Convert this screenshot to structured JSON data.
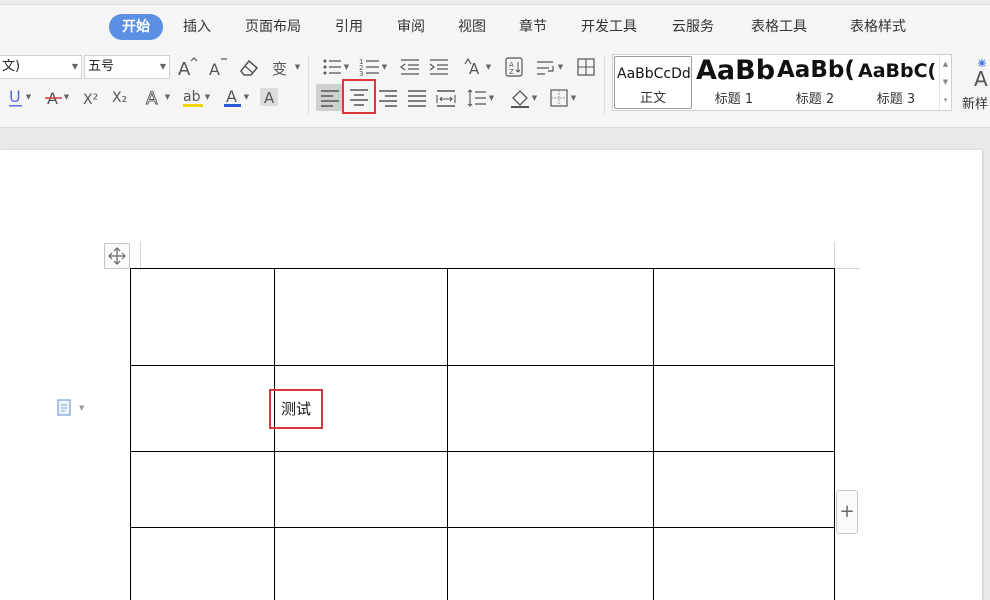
{
  "ribbon": {
    "tabs": [
      {
        "label": "开始",
        "active": true
      },
      {
        "label": "插入"
      },
      {
        "label": "页面布局"
      },
      {
        "label": "引用"
      },
      {
        "label": "审阅"
      },
      {
        "label": "视图"
      },
      {
        "label": "章节"
      },
      {
        "label": "开发工具"
      },
      {
        "label": "云服务"
      },
      {
        "label": "表格工具"
      },
      {
        "label": "表格样式"
      }
    ],
    "font_name": "文)",
    "font_size": "五号",
    "styles": [
      {
        "preview": "AaBbCcDd",
        "name": "正文",
        "selected": true
      },
      {
        "preview": "AaBb",
        "name": "标题 1"
      },
      {
        "preview": "AaBb(",
        "name": "标题 2"
      },
      {
        "preview": "AaBbC(",
        "name": "标题 3"
      }
    ],
    "new_style_label": "新样",
    "icon_glyphs": {
      "grow_font": "A",
      "shrink_font": "A",
      "underline": "U",
      "strikethrough": "A",
      "superscript": "X²",
      "subscript": "X₂",
      "text_effect": "A",
      "highlight": "ab",
      "font_color": "A",
      "char_shading": "A",
      "phonetic": "变"
    },
    "colors": {
      "highlight": "#f2d600",
      "font_color": "#2c5bd8",
      "accent": "#5b8fe3",
      "annotation": "#d9363e"
    }
  },
  "document": {
    "table": {
      "rows": [
        [
          "",
          "",
          "",
          ""
        ],
        [
          "",
          "测试",
          "",
          ""
        ],
        [
          "",
          "",
          "",
          ""
        ],
        [
          "",
          "",
          "",
          ""
        ]
      ]
    },
    "add_row_symbol": "+"
  }
}
